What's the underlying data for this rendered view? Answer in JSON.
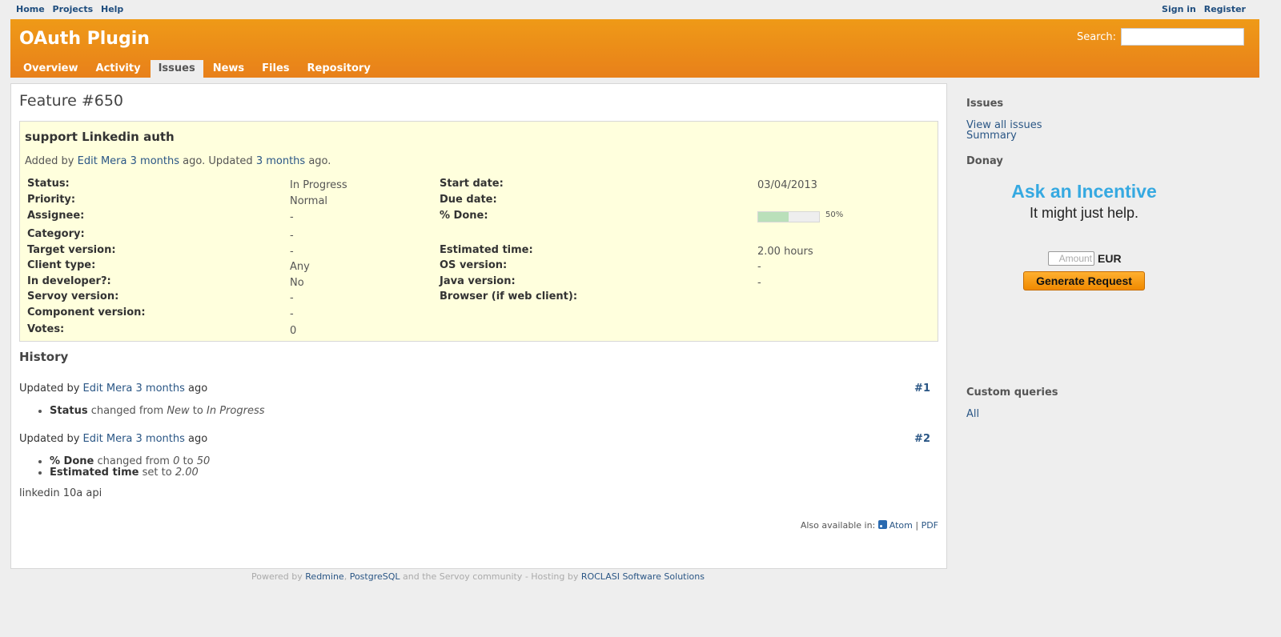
{
  "top_menu": {
    "left": [
      "Home",
      "Projects",
      "Help"
    ],
    "right": [
      "Sign in",
      "Register"
    ]
  },
  "header": {
    "title": "OAuth Plugin",
    "search_label": "Search:"
  },
  "main_menu": [
    "Overview",
    "Activity",
    "Issues",
    "News",
    "Files",
    "Repository"
  ],
  "issue": {
    "heading": "Feature #650",
    "subject": "support Linkedin auth",
    "added_prefix": "Added by ",
    "author": "Edit Mera",
    "created": "3 months",
    "mid_text": " ago. Updated ",
    "updated": "3 months",
    "end_text": " ago.",
    "left_attrs": [
      {
        "label": "Status:",
        "value": "In Progress"
      },
      {
        "label": "Priority:",
        "value": "Normal"
      },
      {
        "label": "Assignee:",
        "value": "-"
      },
      {
        "label": "Category:",
        "value": "-"
      },
      {
        "label": "Target version:",
        "value": "-"
      },
      {
        "label": "Client type:",
        "value": "Any"
      },
      {
        "label": "In developer?:",
        "value": "No"
      },
      {
        "label": "Servoy version:",
        "value": "-"
      },
      {
        "label": "Component version:",
        "value": "-"
      },
      {
        "label": "Votes:",
        "value": "0"
      }
    ],
    "right_attrs": [
      {
        "label": "Start date:",
        "value": "03/04/2013"
      },
      {
        "label": "Due date:",
        "value": ""
      },
      {
        "label": "% Done:",
        "value": ""
      },
      {
        "label": "Estimated time:",
        "value": "2.00 hours"
      },
      {
        "label": "OS version:",
        "value": "-"
      },
      {
        "label": "Java version:",
        "value": "-"
      },
      {
        "label": "Browser (if web client):",
        "value": ""
      }
    ],
    "done_percent": 50,
    "done_text": "50%"
  },
  "history": {
    "title": "History",
    "journals": [
      {
        "prefix": "Updated by ",
        "author": "Edit Mera",
        "ago": "3 months",
        "suffix": " ago",
        "number": "#1",
        "details": [
          {
            "field": "Status",
            "text": " changed from ",
            "from": "New",
            "to_text": " to ",
            "to": "In Progress"
          }
        ]
      },
      {
        "prefix": "Updated by ",
        "author": "Edit Mera",
        "ago": "3 months",
        "suffix": " ago",
        "number": "#2",
        "details": [
          {
            "field": "% Done",
            "text": " changed from ",
            "from": "0",
            "to_text": " to ",
            "to": "50"
          },
          {
            "field": "Estimated time",
            "text": " set to ",
            "from": "",
            "to_text": "",
            "to": "2.00"
          }
        ],
        "notes": "linkedin 10a api"
      }
    ],
    "also_available": "Also available in: ",
    "formats": [
      "Atom",
      "PDF"
    ],
    "separator": " | "
  },
  "sidebar": {
    "issues_title": "Issues",
    "links": [
      "View all issues",
      "Summary"
    ],
    "donate_title": "Donay",
    "incentive_title": "Ask an Incentive",
    "incentive_sub": "It might just help.",
    "amount_placeholder": "Amount",
    "currency": "EUR",
    "button": "Generate Request",
    "custom_title": "Custom queries",
    "custom_link": "All"
  },
  "footer": {
    "powered": "Powered by ",
    "redmine": "Redmine",
    "comma": ", ",
    "postgres": "PostgreSQL",
    "community": " and the Servoy community - Hosting by ",
    "host": "ROCLASI Software Solutions"
  },
  "colors": {
    "header": "#e8801a",
    "link": "#2a5685",
    "issue_bg": "#ffffdd",
    "progress_fill": "#bae0ba",
    "incentive": "#36a9e1"
  }
}
